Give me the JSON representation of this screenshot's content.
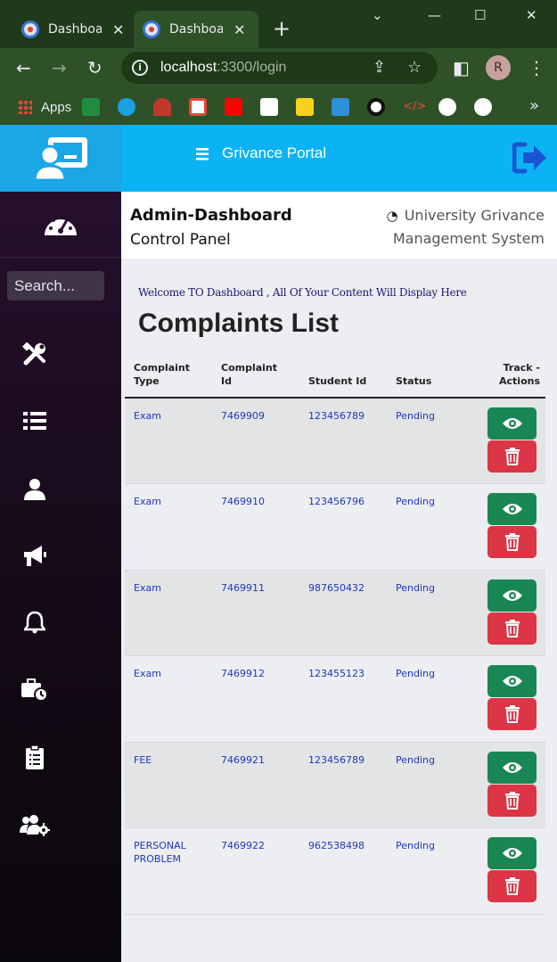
{
  "browser": {
    "tabs": [
      {
        "title": "Dashboard"
      },
      {
        "title": "Dashboard"
      }
    ],
    "url_host": "localhost",
    "url_rest": ":3300/login",
    "profile_initial": "R",
    "bookmarks": {
      "apps_label": "Apps",
      "more": "»"
    }
  },
  "brand": {
    "accent": "#0bb3f4",
    "sidebar_bg": "#29102f"
  },
  "topbar": {
    "title": "Grivance Portal"
  },
  "header": {
    "title": "Admin-Dashboard",
    "subtitle": "Control Panel",
    "right_line1": "University Grivance",
    "right_line2": "Management System"
  },
  "sidebar": {
    "search_placeholder": "Search...",
    "items": [
      {
        "icon": "tools-icon"
      },
      {
        "icon": "list-icon"
      },
      {
        "icon": "user-icon"
      },
      {
        "icon": "megaphone-icon"
      },
      {
        "icon": "bell-icon"
      },
      {
        "icon": "briefcase-clock-icon"
      },
      {
        "icon": "clipboard-icon"
      },
      {
        "icon": "users-cog-icon"
      }
    ]
  },
  "main": {
    "welcome": "Welcome TO Dashboard , All Of Your Content Will Display Here",
    "heading": "Complaints List",
    "columns": [
      "Complaint Type",
      "Complaint Id",
      "Student Id",
      "Status",
      "Track - Actions"
    ],
    "rows": [
      {
        "type": "Exam",
        "id": "7469909",
        "student": "123456789",
        "status": "Pending"
      },
      {
        "type": "Exam",
        "id": "7469910",
        "student": "123456796",
        "status": "Pending"
      },
      {
        "type": "Exam",
        "id": "7469911",
        "student": "987650432",
        "status": "Pending"
      },
      {
        "type": "Exam",
        "id": "7469912",
        "student": "123455123",
        "status": "Pending"
      },
      {
        "type": "FEE",
        "id": "7469921",
        "student": "123456789",
        "status": "Pending"
      },
      {
        "type": "PERSONAL PROBLEM",
        "id": "7469922",
        "student": "962538498",
        "status": "Pending"
      }
    ]
  }
}
